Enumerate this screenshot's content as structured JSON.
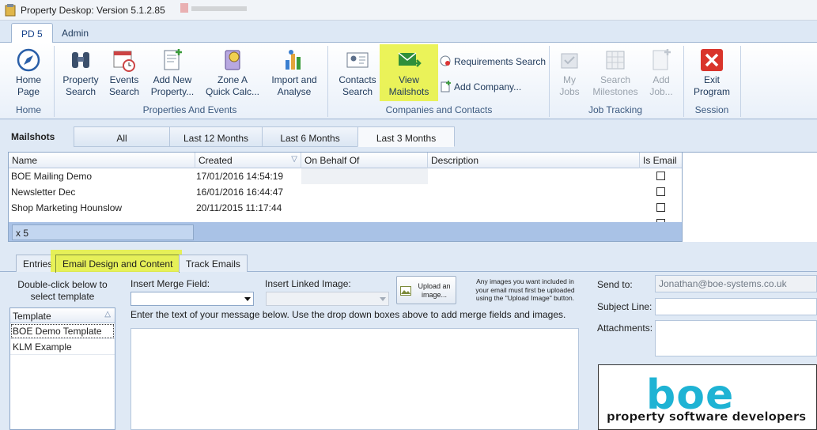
{
  "window": {
    "title": "Property Deskop: Version 5.1.2.85"
  },
  "ribbon": {
    "tabs": [
      "PD 5",
      "Admin"
    ],
    "groups": {
      "home": {
        "label": "Home",
        "home_page": "Home\nPage"
      },
      "properties": {
        "label": "Properties And Events",
        "property_search": "Property\nSearch",
        "events_search": "Events\nSearch",
        "add_property": "Add New\nProperty...",
        "zone_a": "Zone A\nQuick Calc...",
        "import_analyse": "Import and\nAnalyse"
      },
      "companies": {
        "label": "Companies and Contacts",
        "contacts_search": "Contacts\nSearch",
        "view_mailshots": "View\nMailshots",
        "requirements_search": "Requirements Search",
        "add_company": "Add Company..."
      },
      "jobs": {
        "label": "Job Tracking",
        "my_jobs": "My\nJobs",
        "search_milestones": "Search\nMilestones",
        "add_job": "Add\nJob..."
      },
      "session": {
        "label": "Session",
        "exit": "Exit\nProgram"
      }
    }
  },
  "mailshots": {
    "title": "Mailshots",
    "filters": [
      "All",
      "Last 12 Months",
      "Last 6 Months",
      "Last 3 Months"
    ],
    "active_filter": "Last 3 Months",
    "columns": [
      "Name",
      "Created",
      "On Behalf Of",
      "Description",
      "Is Email"
    ],
    "rows": [
      {
        "name": "BOE Mailing Demo",
        "created": "17/01/2016 14:54:19",
        "on_behalf_of": "",
        "description": ""
      },
      {
        "name": "Newsletter Dec",
        "created": "16/01/2016 16:44:47",
        "on_behalf_of": "",
        "description": ""
      },
      {
        "name": "Shop Marketing Hounslow",
        "created": "20/11/2015 11:17:44",
        "on_behalf_of": "",
        "description": ""
      }
    ],
    "count": "x 5"
  },
  "detail_tabs": [
    "Entries",
    "Email Design and Content",
    "Track Emails"
  ],
  "email_design": {
    "template_hint": "Double-click below to\nselect template",
    "template_header": "Template",
    "templates": [
      "BOE Demo Template",
      "KLM Example"
    ],
    "merge_field_label": "Insert Merge Field:",
    "linked_image_label": "Insert Linked Image:",
    "upload_button": "Upload an\nimage...",
    "upload_note": "Any images you want included in\nyour email must first be uploaded\nusing the \"Upload Image\" button.",
    "instructions": "Enter the text of your message below. Use the drop down boxes above to add merge fields and images.",
    "send_to_label": "Send to:",
    "send_to_value": "Jonathan@boe-systems.co.uk",
    "subject_label": "Subject Line:",
    "attachments_label": "Attachments:",
    "logo_text": "boe",
    "logo_tagline": "property software developers"
  },
  "colors": {
    "highlight": "#e8f13c",
    "accent": "#1fb3d4",
    "exit_red": "#d9342b"
  }
}
